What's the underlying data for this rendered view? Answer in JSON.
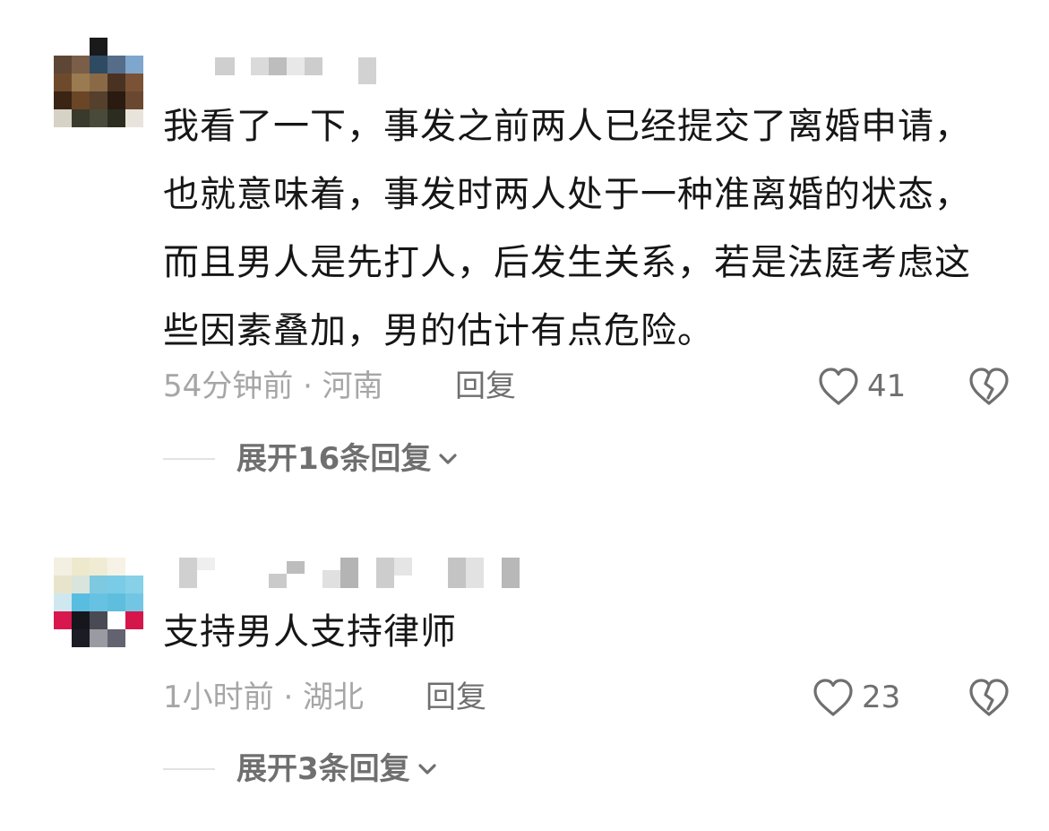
{
  "comments": [
    {
      "text": "我看了一下，事发之前两人已经提交了离婚申请，也就意味着，事发时两人处于一种准离婚的状态，而且男人是先打人，后发生关系，若是法庭考虑这些因素叠加，男的估计有点危险。",
      "meta": "54分钟前 · 河南",
      "reply_label": "回复",
      "likes": "41",
      "expand_label": "展开16条回复"
    },
    {
      "text": "支持男人支持律师",
      "meta": "1小时前 · 湖北",
      "reply_label": "回复",
      "likes": "23",
      "expand_label": "展开3条回复"
    }
  ],
  "icons": {
    "like": "heart-outline-icon",
    "dislike": "broken-heart-icon",
    "expand": "chevron-down-icon"
  },
  "colors": {
    "text": "#161616",
    "meta": "#a6a6a6",
    "action": "#6f6f6f"
  }
}
